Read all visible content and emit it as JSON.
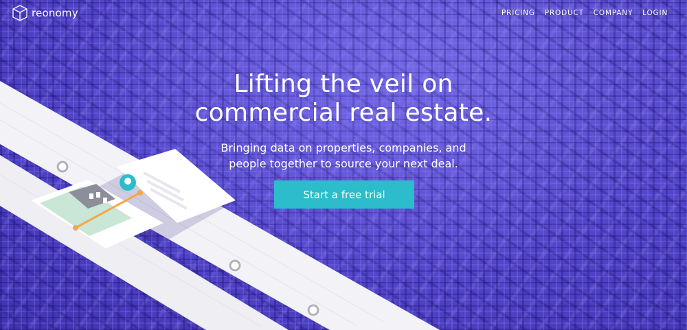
{
  "brand": {
    "name": "reonomy"
  },
  "nav": {
    "items": [
      {
        "label": "PRICING"
      },
      {
        "label": "PRODUCT"
      },
      {
        "label": "COMPANY"
      },
      {
        "label": "LOGIN"
      }
    ]
  },
  "hero": {
    "title_line1": "Lifting the veil on",
    "title_line2": "commercial real estate.",
    "subtitle_line1": "Bringing data on properties, companies, and",
    "subtitle_line2": "people together to source your next deal."
  },
  "cta": {
    "label": "Start a free trial"
  },
  "colors": {
    "background": "#5547cc",
    "cta": "#2cbccb",
    "accent_orange": "#f5a64a",
    "teal": "#2cbccb"
  }
}
